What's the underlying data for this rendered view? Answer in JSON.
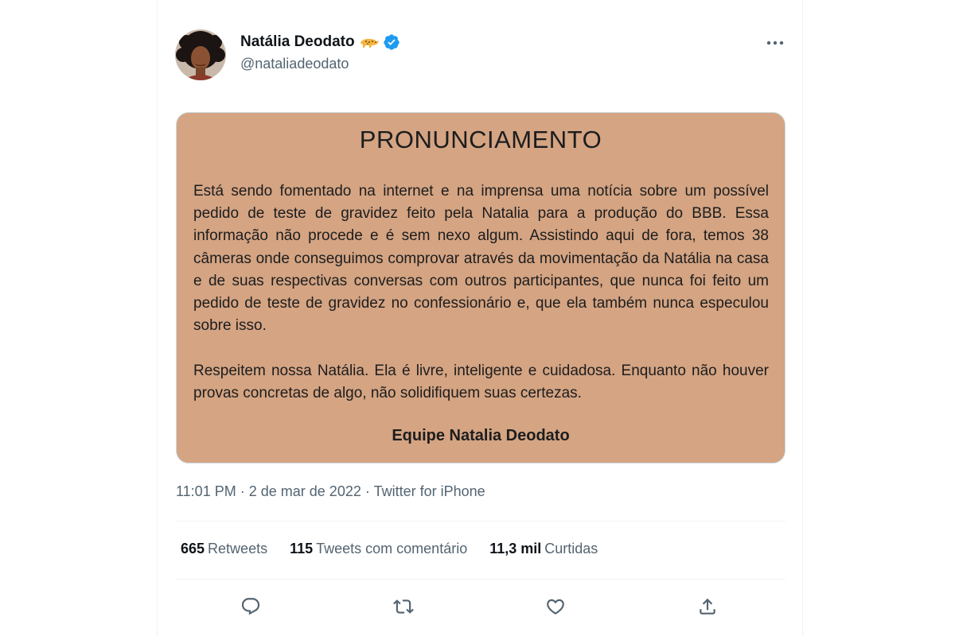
{
  "author": {
    "display_name": "Natália Deodato",
    "handle": "@nataliadeodato",
    "emoji": "leopard-emoji",
    "verified": true
  },
  "statement": {
    "title": "PRONUNCIAMENTO",
    "paragraph_1": "Está sendo fomentado na internet e na imprensa uma notícia sobre um possível pedido de teste de gravidez feito pela Natalia para a produção do BBB. Essa informação não procede e é sem nexo algum. Assistindo aqui de fora, temos 38 câmeras onde conseguimos comprovar através da movimentação da Natália na casa e de suas respectivas conversas com outros participantes, que nunca foi feito um pedido de teste de gravidez no confessionário e, que ela também nunca especulou sobre isso.",
    "paragraph_2": "Respeitem nossa Natália. Ela é livre, inteligente e cuidadosa. Enquanto não houver provas concretas de algo, não solidifiquem suas certezas.",
    "signature": "Equipe Natalia Deodato",
    "background_color": "#d4a483"
  },
  "meta": {
    "time": "11:01 PM",
    "date": "2 de mar de 2022",
    "source": "Twitter for iPhone",
    "separator": "·"
  },
  "stats": {
    "retweets_count": "665",
    "retweets_label": "Retweets",
    "quotes_count": "115",
    "quotes_label": "Tweets com comentário",
    "likes_count": "11,3 mil",
    "likes_label": "Curtidas"
  },
  "actions": [
    "reply-icon",
    "retweet-icon",
    "like-icon",
    "share-icon"
  ],
  "colors": {
    "text_primary": "#0f1419",
    "text_secondary": "#536471",
    "verified_blue": "#1d9bf0",
    "divider": "#eff3f4"
  }
}
